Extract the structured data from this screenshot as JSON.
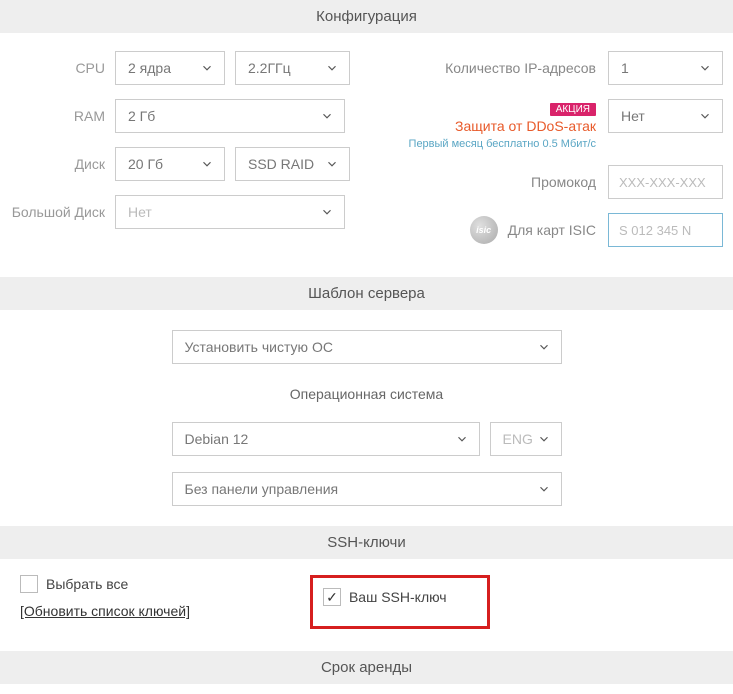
{
  "sections": {
    "config": "Конфигурация",
    "template": "Шаблон сервера",
    "os_header": "Операционная система",
    "ssh": "SSH-ключи",
    "rental": "Срок аренды"
  },
  "config": {
    "cpu_label": "CPU",
    "cpu_cores": "2 ядра",
    "cpu_freq": "2.2ГГц",
    "ram_label": "RAM",
    "ram_value": "2 Гб",
    "disk_label": "Диск",
    "disk_size": "20 Гб",
    "disk_type": "SSD RAID",
    "bigdisk_label": "Большой Диск",
    "bigdisk_value": "Нет",
    "ip_label": "Количество IP-адресов",
    "ip_value": "1",
    "promo_badge": "АКЦИЯ",
    "ddos_label": "Защита от DDoS-атак",
    "ddos_sub": "Первый месяц бесплатно 0.5 Мбит/c",
    "ddos_value": "Нет",
    "promo_label": "Промокод",
    "promo_placeholder": "XXX-XXX-XXX",
    "isic_label": "Для карт ISIC",
    "isic_placeholder": "S 012 345 N",
    "isic_icon_text": "isic"
  },
  "template": {
    "install": "Установить чистую ОС",
    "os": "Debian 12",
    "lang": "ENG",
    "panel": "Без панели управления"
  },
  "ssh": {
    "select_all": "Выбрать все",
    "refresh": "[Обновить список ключей]",
    "your_key": "Ваш SSH-ключ"
  }
}
